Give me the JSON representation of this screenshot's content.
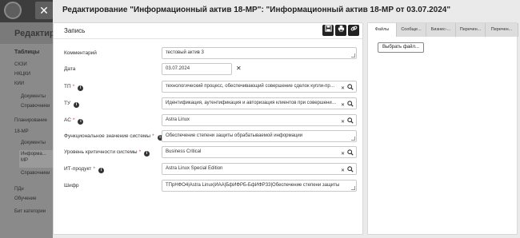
{
  "background": {
    "title": "Редактиро",
    "sidebar_items": [
      {
        "text": "Таблицы",
        "kind": "hdr"
      },
      {
        "text": "СКЗИ",
        "kind": "item"
      },
      {
        "text": "НКЦКИ",
        "kind": "item"
      },
      {
        "text": "КИИ",
        "kind": "item"
      },
      {
        "text": "Документы",
        "kind": "sub"
      },
      {
        "text": "Справочники",
        "kind": "sub"
      },
      {
        "text": "Планирование",
        "kind": "item"
      },
      {
        "text": "18-МР",
        "kind": "item"
      },
      {
        "text": "Документы",
        "kind": "sub"
      },
      {
        "text": "Информа...",
        "kind": "sub"
      },
      {
        "text": "МР",
        "kind": "sub"
      },
      {
        "text": "Справочники",
        "kind": "sub"
      },
      {
        "text": "ПДн",
        "kind": "item"
      },
      {
        "text": "Обучение",
        "kind": "item"
      },
      {
        "text": "Бит категории",
        "kind": "item"
      }
    ]
  },
  "modal": {
    "title": "Редактирование \"Информационный актив 18-МР\": \"Информационный актив 18-МР от 03.07.2024\"",
    "close_icon": "✕",
    "panel_label": "Запись",
    "toolbar": {
      "save_icon": "floppy-disk",
      "print_icon": "printer",
      "link_icon": "link"
    },
    "fields": [
      {
        "label": "Комментарий",
        "required": false,
        "info": false,
        "value": "тестовый актив 3",
        "type": "textarea"
      },
      {
        "label": "Дата",
        "required": false,
        "info": false,
        "value": "03.07.2024",
        "type": "date"
      },
      {
        "label": "ТП",
        "required": true,
        "info": true,
        "value": "технологический процесс, обеспечивающий совершение сделок купли-продажи ценных бумаг",
        "type": "lookup"
      },
      {
        "label": "ТУ",
        "required": false,
        "info": true,
        "value": "Идентификация, аутентификация и авторизация клиентов при совершении действий",
        "type": "lookup"
      },
      {
        "label": "АС",
        "required": true,
        "info": true,
        "value": "Astra Linux",
        "type": "lookup"
      },
      {
        "label": "Функциональное значение системы",
        "required": true,
        "info": true,
        "value": "Обеспечение степени защиты обрабатываемой информации",
        "type": "textarea"
      },
      {
        "label": "Уровень критичности системы",
        "required": true,
        "info": true,
        "value": "Business Critical",
        "type": "lookup"
      },
      {
        "label": "ИТ-продукт",
        "required": true,
        "info": true,
        "value": "Astra Linux Special Edition",
        "type": "lookup"
      },
      {
        "label": "Шифр",
        "required": false,
        "info": false,
        "value": "ТПрНФО4|Astra Linux|ИАА|БфИФРБ-БфИФРЗ3|Обеспечение степени защиты",
        "type": "textarea"
      }
    ],
    "right_tabs": [
      "Файлы",
      "Сообще...",
      "Бизнес-...",
      "Перечен...",
      "Перечен..."
    ],
    "choose_file_label": "Выбрать файл..."
  }
}
